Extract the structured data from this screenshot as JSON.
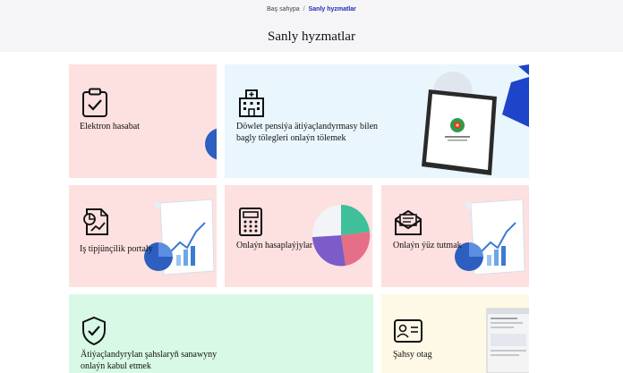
{
  "breadcrumb": {
    "home": "Baş sahypa",
    "separator": "/",
    "current": "Sanly hyzmatlar"
  },
  "page_title": "Sanly hyzmatlar",
  "cards": [
    {
      "label": "Elektron hasabat",
      "icon": "clipboard-check-icon"
    },
    {
      "label_line1": "Döwlet pensiýa ätiýaçlandyrmasy bilen",
      "label_line2": "bagly tölegleri onlaýn tölemek",
      "icon": "building-icon"
    },
    {
      "label": "Iş tipjünçilik portaly",
      "icon": "document-chart-icon"
    },
    {
      "label": "Onlaýn hasaplaýjylar",
      "icon": "calculator-icon"
    },
    {
      "label": "Onlaýn ýüz tutmak",
      "icon": "envelope-icon"
    },
    {
      "label_line1": "Ätiýaçlandyrylan şahslaryň sanawyny",
      "label_line2": "onlaýn kabul etmek",
      "icon": "shield-check-icon"
    },
    {
      "label": "Şahsy otag",
      "icon": "id-card-icon"
    }
  ],
  "colors": {
    "pink": "#fde0e0",
    "blue": "#eaf6fd",
    "green": "#d8f9e6",
    "cream": "#fdf9e6",
    "accent": "#1f2db8"
  }
}
